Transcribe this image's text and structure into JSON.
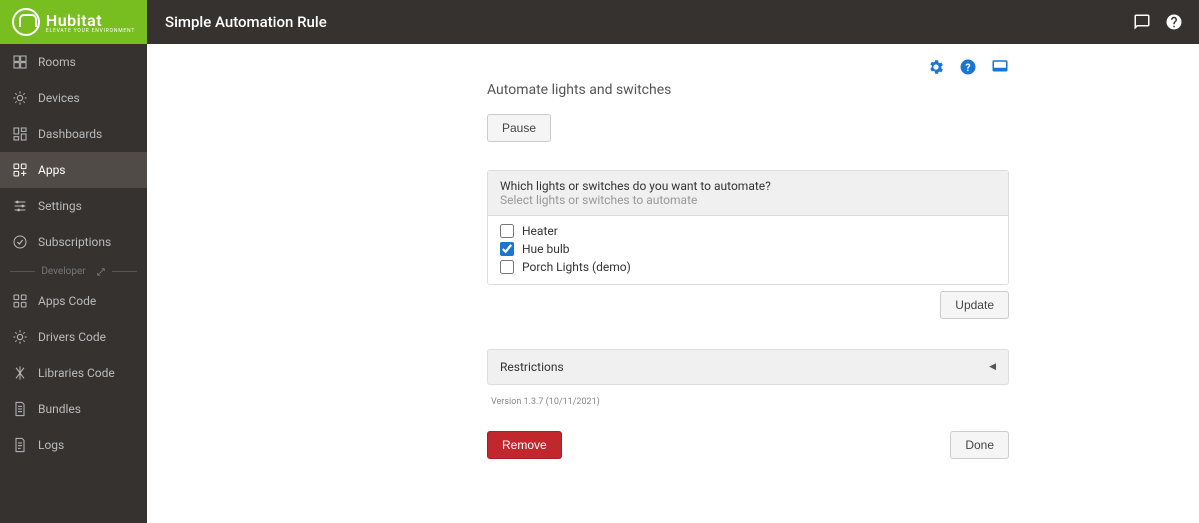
{
  "header": {
    "brand_name": "Hubitat",
    "brand_tag": "ELEVATE YOUR ENVIRONMENT",
    "title": "Simple Automation Rule"
  },
  "sidebar": {
    "items": [
      {
        "label": "Rooms",
        "icon": "rooms-icon",
        "active": false
      },
      {
        "label": "Devices",
        "icon": "devices-icon",
        "active": false
      },
      {
        "label": "Dashboards",
        "icon": "dashboards-icon",
        "active": false
      },
      {
        "label": "Apps",
        "icon": "apps-icon",
        "active": true
      },
      {
        "label": "Settings",
        "icon": "settings-icon",
        "active": false
      },
      {
        "label": "Subscriptions",
        "icon": "subscriptions-icon",
        "active": false
      }
    ],
    "dev_label": "Developer",
    "dev_items": [
      {
        "label": "Apps Code",
        "icon": "apps-code-icon"
      },
      {
        "label": "Drivers Code",
        "icon": "drivers-code-icon"
      },
      {
        "label": "Libraries Code",
        "icon": "libraries-code-icon"
      },
      {
        "label": "Bundles",
        "icon": "bundles-icon"
      },
      {
        "label": "Logs",
        "icon": "logs-icon"
      }
    ]
  },
  "main": {
    "subtitle": "Automate lights and switches",
    "pause_label": "Pause",
    "panel": {
      "question": "Which lights or switches do you want to automate?",
      "hint": "Select lights or switches to automate",
      "options": [
        {
          "label": "Heater",
          "checked": false
        },
        {
          "label": "Hue bulb",
          "checked": true
        },
        {
          "label": "Porch Lights (demo)",
          "checked": false
        }
      ]
    },
    "update_label": "Update",
    "restrictions_label": "Restrictions",
    "version_text": "Version 1.3.7 (10/11/2021)",
    "remove_label": "Remove",
    "done_label": "Done"
  }
}
